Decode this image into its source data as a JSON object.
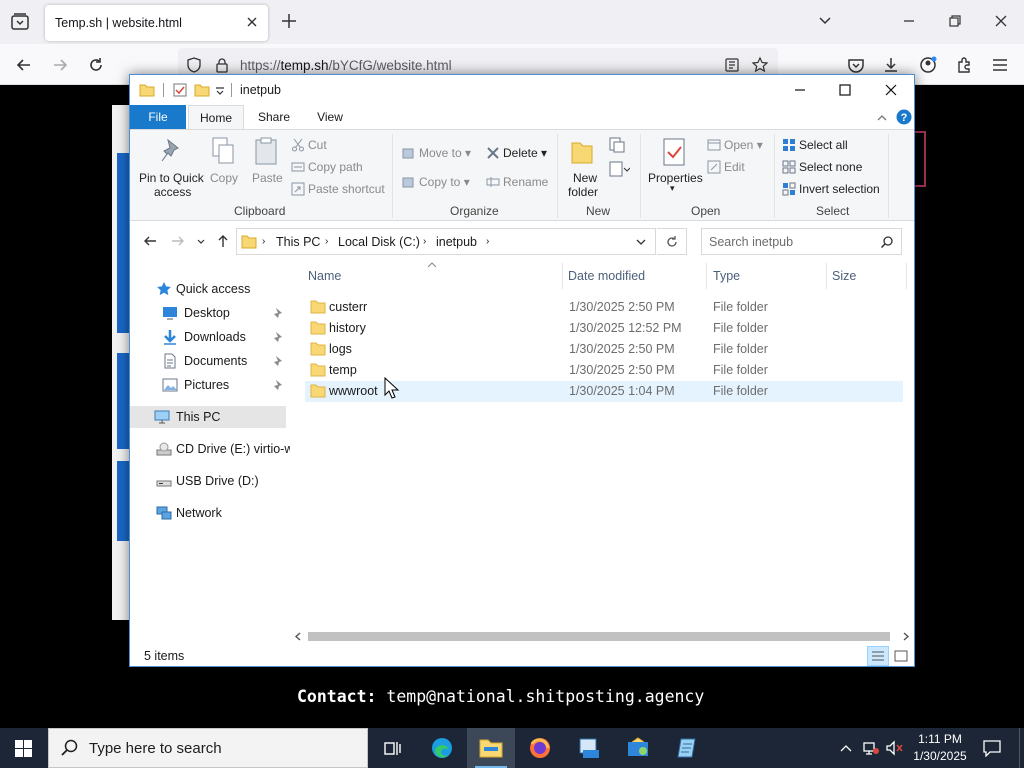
{
  "browser": {
    "tab_title": "Temp.sh | website.html",
    "url_prefix": "https://",
    "url_host": "temp.sh",
    "url_path": "/bYCfG/website.html"
  },
  "page": {
    "contact_label": "Contact:",
    "contact_email": "temp@national.shitposting.agency"
  },
  "explorer": {
    "title": "inetpub",
    "ribbon_tabs": [
      "File",
      "Home",
      "Share",
      "View"
    ],
    "clipboard": {
      "pin_label_1": "Pin to Quick",
      "pin_label_2": "access",
      "copy": "Copy",
      "paste": "Paste",
      "cut": "Cut",
      "copy_path": "Copy path",
      "paste_shortcut": "Paste shortcut",
      "group": "Clipboard"
    },
    "organize": {
      "move_to": "Move to",
      "copy_to": "Copy to",
      "delete": "Delete",
      "rename": "Rename",
      "group": "Organize"
    },
    "new": {
      "new_folder_1": "New",
      "new_folder_2": "folder",
      "group": "New"
    },
    "open": {
      "properties": "Properties",
      "open": "Open",
      "edit": "Edit",
      "group": "Open"
    },
    "select": {
      "select_all": "Select all",
      "select_none": "Select none",
      "invert": "Invert selection",
      "group": "Select"
    },
    "address": {
      "crumbs": [
        "This PC",
        "Local Disk (C:)",
        "inetpub"
      ],
      "search_placeholder": "Search inetpub"
    },
    "nav": {
      "quick_access": "Quick access",
      "desktop": "Desktop",
      "downloads": "Downloads",
      "documents": "Documents",
      "pictures": "Pictures",
      "this_pc": "This PC",
      "cd_drive": "CD Drive (E:) virtio-w",
      "usb_drive": "USB Drive (D:)",
      "network": "Network"
    },
    "columns": {
      "name": "Name",
      "date": "Date modified",
      "type": "Type",
      "size": "Size"
    },
    "files": [
      {
        "name": "custerr",
        "date": "1/30/2025 2:50 PM",
        "type": "File folder"
      },
      {
        "name": "history",
        "date": "1/30/2025 12:52 PM",
        "type": "File folder"
      },
      {
        "name": "logs",
        "date": "1/30/2025 2:50 PM",
        "type": "File folder"
      },
      {
        "name": "temp",
        "date": "1/30/2025 2:50 PM",
        "type": "File folder"
      },
      {
        "name": "wwwroot",
        "date": "1/30/2025 1:04 PM",
        "type": "File folder"
      }
    ],
    "status": "5 items"
  },
  "taskbar": {
    "search_placeholder": "Type here to search",
    "time": "1:11 PM",
    "date": "1/30/2025"
  },
  "colors": {
    "accent": "#1979ca",
    "folder": "#f8d775",
    "taskbar": "#1c2636"
  }
}
